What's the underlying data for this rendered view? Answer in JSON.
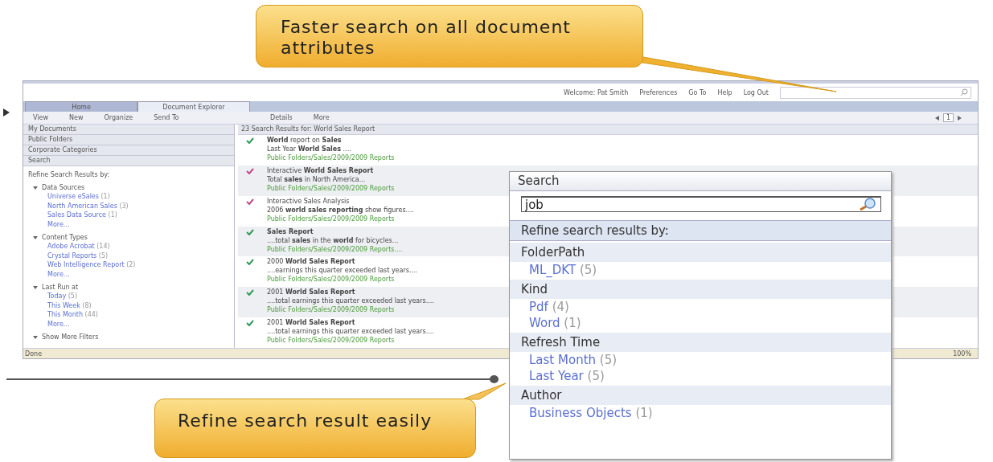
{
  "callouts": [
    {
      "text": "Faster search on all document attributes",
      "kind": "top"
    },
    {
      "text": "Refine search result easily",
      "kind": "bottom"
    }
  ],
  "app": {
    "header": {
      "welcome": "Welcome: Pat Smith",
      "links": [
        "Preferences",
        "Go To",
        "Help",
        "Log Out"
      ]
    },
    "tabs": [
      {
        "label": "Home",
        "selected": false
      },
      {
        "label": "Document Explorer",
        "selected": true
      }
    ],
    "toolbar_left": [
      "View",
      "New",
      "Organize",
      "Send To"
    ],
    "toolbar_right": [
      "Details",
      "More"
    ],
    "pager": {
      "page": "1"
    },
    "sidebar": {
      "sections": [
        "My Documents",
        "Public Folders",
        "Corporate Categories",
        "Search"
      ],
      "refine_title": "Refine Search Results by:",
      "groups": [
        {
          "label": "Data Sources",
          "expanded": true,
          "children": [
            {
              "label": "Universe eSales",
              "count": "(1)"
            },
            {
              "label": "North American Sales",
              "count": "(3)"
            },
            {
              "label": "Sales Data Source",
              "count": "(1)"
            },
            {
              "label": "More..."
            }
          ]
        },
        {
          "label": "Content Types",
          "expanded": true,
          "children": [
            {
              "label": "Adobe Acrobat",
              "count": "(14)"
            },
            {
              "label": "Crystal Reports",
              "count": "(5)"
            },
            {
              "label": "Web Intelligence Report",
              "count": "(2)"
            },
            {
              "label": "More..."
            }
          ]
        },
        {
          "label": "Last Run at",
          "expanded": true,
          "children": [
            {
              "label": "Today",
              "count": "(5)"
            },
            {
              "label": "This Week",
              "count": "(8)"
            },
            {
              "label": "This Month",
              "count": "(44)"
            },
            {
              "label": "More..."
            }
          ]
        },
        {
          "label": "Show More Filters",
          "expanded": true
        }
      ]
    },
    "results_header": "23 Search Results for: World Sales Report",
    "results": [
      {
        "title": "**World** report on **Sales**",
        "snippet": "Last Year **World Sales** ....",
        "path": "Public Folders/Sales/2009/2009 Reports",
        "color": "#2e9a5a"
      },
      {
        "title": "Interactive **World Sales Report**",
        "snippet": "Total **sales** in North America...",
        "path": "Public Folders/Sales/2009/2009 Reports",
        "color": "#c04a8a"
      },
      {
        "title": "Interactive Sales Analysis",
        "snippet": "2006 **world sales reporting** show figures....",
        "path": "Public Folders/Sales/2009/2009 Reports",
        "color": "#c04a8a"
      },
      {
        "title": "**Sales Report**",
        "snippet": "....total **sales** in the **world** for bicycles...",
        "path": "Public Folders/Sales/2009/2009 Reports....",
        "color": "#2e9a5a"
      },
      {
        "title": "2000 **World Sales Report**",
        "snippet": "....earnings this quarter exceeded last years....",
        "path": "Public Folders/Sales/2009/2009 Reports",
        "color": "#2e9a5a"
      },
      {
        "title": "2001 **World Sales Report**",
        "snippet": "....total earnings this quarter exceeded last years....",
        "path": "Public Folders/Sales/2009/2009 Reports",
        "color": "#2e9a5a"
      },
      {
        "title": "2001 **World Sales Report**",
        "snippet": "....total earnings this quarter exceeded last years....",
        "path": "Public Folders/Sales/2009/2009 Reports",
        "color": "#2e9a5a"
      }
    ],
    "status_bar": {
      "text": "Done",
      "zoom": "100%"
    }
  },
  "search_popup": {
    "title": "Search",
    "value": "job",
    "refine_title": "Refine search results by:",
    "groups": [
      {
        "label": "FolderPath",
        "items": [
          {
            "label": "ML_DKT",
            "count": "(5)"
          }
        ]
      },
      {
        "label": "Kind",
        "items": [
          {
            "label": "Pdf",
            "count": "(4)"
          },
          {
            "label": "Word",
            "count": "(1)"
          }
        ]
      },
      {
        "label": "Refresh Time",
        "items": [
          {
            "label": "Last Month",
            "count": "(5)"
          },
          {
            "label": "Last Year",
            "count": "(5)"
          }
        ]
      },
      {
        "label": "Author",
        "items": [
          {
            "label": "Business Objects",
            "count": "(1)"
          }
        ]
      }
    ]
  }
}
